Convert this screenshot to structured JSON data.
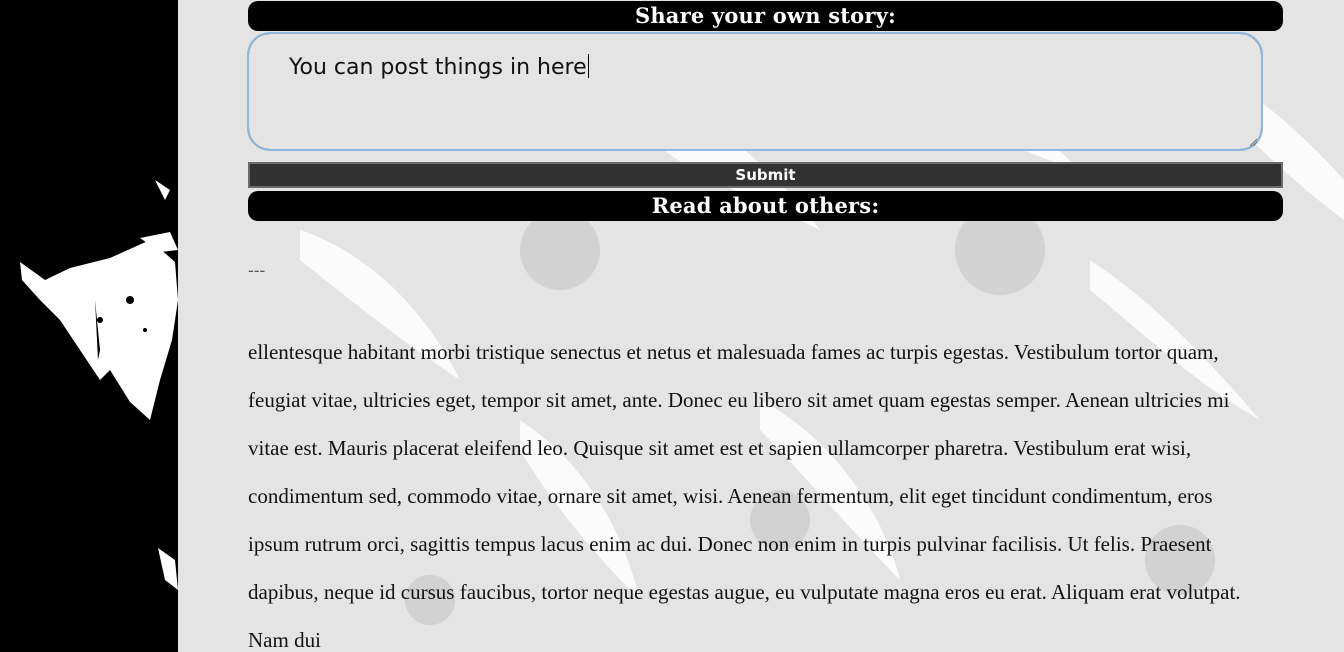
{
  "share": {
    "header": "Share your own story:",
    "textarea_value": "You can post things in here",
    "submit_label": "Submit"
  },
  "read": {
    "header": "Read about others:",
    "divider": "---",
    "story_text": "ellentesque habitant morbi tristique senectus et netus et malesuada fames ac turpis egestas. Vestibulum tortor quam, feugiat vitae, ultricies eget, tempor sit amet, ante. Donec eu libero sit amet quam egestas semper. Aenean ultricies mi vitae est. Mauris placerat eleifend leo. Quisque sit amet est et sapien ullamcorper pharetra. Vestibulum erat wisi, condimentum sed, commodo vitae, ornare sit amet, wisi. Aenean fermentum, elit eget tincidunt condimentum, eros ipsum rutrum orci, sagittis tempus lacus enim ac dui. Donec non enim in turpis pulvinar facilisis. Ut felis. Praesent dapibus, neque id cursus faucibus, tortor neque egestas augue, eu vulputate magna eros eu erat. Aliquam erat volutpat. Nam dui"
  },
  "colors": {
    "page_background": "#e4e4e4",
    "header_background": "#000000",
    "header_text": "#ffffff",
    "textarea_focus_ring": "#8fb7dd",
    "submit_background": "#323232",
    "left_panel": "#000000"
  }
}
